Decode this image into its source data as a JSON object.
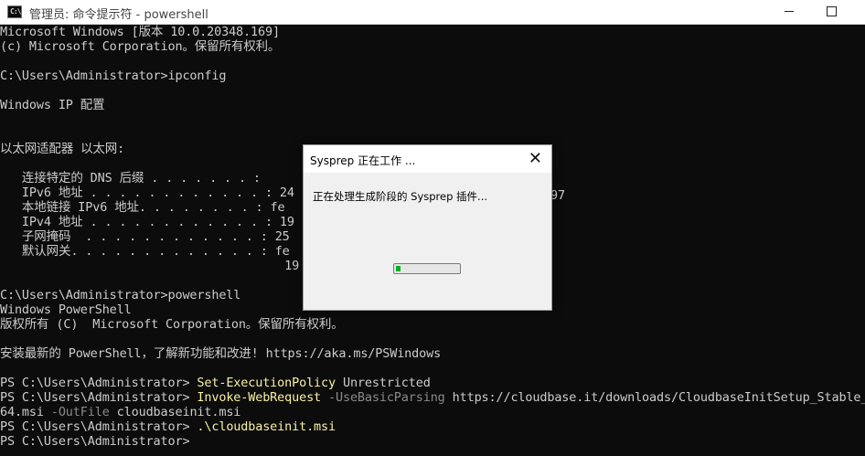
{
  "window": {
    "title": "管理员: 命令提示符 - powershell",
    "app_icon_text": "C:\\",
    "minimize_glyph": "—",
    "maximize_glyph": "☐"
  },
  "console": {
    "lines": [
      [
        {
          "t": "Microsoft Windows [版本 10.0.20348.169]"
        }
      ],
      [
        {
          "t": "(c) Microsoft Corporation。保留所有权利。"
        }
      ],
      [
        {
          "t": ""
        }
      ],
      [
        {
          "t": "C:\\Users\\Administrator>ipconfig"
        }
      ],
      [
        {
          "t": ""
        }
      ],
      [
        {
          "t": "Windows IP 配置"
        }
      ],
      [
        {
          "t": ""
        }
      ],
      [
        {
          "t": ""
        }
      ],
      [
        {
          "t": "以太网适配器 以太网:"
        }
      ],
      [
        {
          "t": ""
        }
      ],
      [
        {
          "t": "   连接特定的 DNS 后缀 . . . . . . . :"
        }
      ],
      [
        {
          "t": "   IPv6 地址 . . . . . . . . . . . . : 24"
        }
      ],
      [
        {
          "t": "   本地链接 IPv6 地址. . . . . . . . : fe"
        }
      ],
      [
        {
          "t": "   IPv4 地址 . . . . . . . . . . . . : 19"
        }
      ],
      [
        {
          "t": "   子网掩码  . . . . . . . . . . . . : 25"
        }
      ],
      [
        {
          "t": "   默认网关. . . . . . . . . . . . . : fe"
        }
      ],
      [
        {
          "t": "                                       19"
        }
      ],
      [
        {
          "t": ""
        }
      ],
      [
        {
          "t": "C:\\Users\\Administrator>powershell"
        }
      ],
      [
        {
          "t": "Windows PowerShell"
        }
      ],
      [
        {
          "t": "版权所有 (C)  Microsoft Corporation。保留所有权利。"
        }
      ],
      [
        {
          "t": ""
        }
      ],
      [
        {
          "t": "安装最新的 PowerShell，了解新功能和改进! https://aka.ms/PSWindows"
        }
      ],
      [
        {
          "t": ""
        }
      ],
      [
        {
          "t": "PS C:\\Users\\Administrator> "
        },
        {
          "t": "Set-ExecutionPolicy",
          "c": "yel"
        },
        {
          "t": " Unrestricted"
        }
      ],
      [
        {
          "t": "PS C:\\Users\\Administrator> "
        },
        {
          "t": "Invoke-WebRequest",
          "c": "yel"
        },
        {
          "t": " -UseBasicParsing",
          "c": "gry"
        },
        {
          "t": " https://cloudbase.it/downloads/CloudbaseInitSetup_Stable_x"
        }
      ],
      [
        {
          "t": "64.msi"
        },
        {
          "t": " -OutFile",
          "c": "gry"
        },
        {
          "t": " cloudbaseinit.msi"
        }
      ],
      [
        {
          "t": "PS C:\\Users\\Administrator> "
        },
        {
          "t": ".\\cloudbaseinit.msi",
          "c": "yel"
        }
      ],
      [
        {
          "t": "PS C:\\Users\\Administrator>"
        }
      ]
    ],
    "fragment_97": "97"
  },
  "dialog": {
    "title": "Sysprep 正在工作 ...",
    "close_glyph": "✕",
    "message": "正在处理生成阶段的 Sysprep 插件...",
    "progress_fraction": 0.08
  },
  "colors": {
    "console_bg": "#0c0c0c",
    "console_text": "#cccccc",
    "command_yellow": "#f9f1a5",
    "param_gray": "#8a8a8a",
    "progress_green": "#06b025"
  }
}
